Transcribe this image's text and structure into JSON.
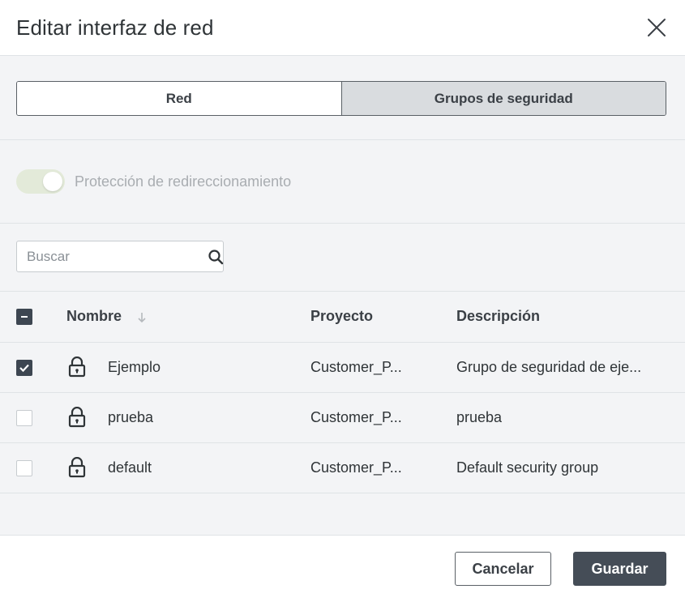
{
  "dialog": {
    "title": "Editar interfaz de red"
  },
  "tabs": [
    {
      "label": "Red",
      "active": true
    },
    {
      "label": "Grupos de seguridad",
      "active": false
    }
  ],
  "toggle": {
    "label": "Protección de redireccionamiento",
    "on": true,
    "disabled": true
  },
  "search": {
    "placeholder": "Buscar",
    "value": ""
  },
  "table": {
    "columns": [
      "Nombre",
      "Proyecto",
      "Descripción"
    ],
    "rows": [
      {
        "name": "Ejemplo",
        "project": "Customer_P...",
        "description": "Grupo de seguridad de eje...",
        "checked": true
      },
      {
        "name": "prueba",
        "project": "Customer_P...",
        "description": "prueba",
        "checked": false
      },
      {
        "name": "default",
        "project": "Customer_P...",
        "description": "Default security group",
        "checked": false
      }
    ]
  },
  "footer": {
    "cancel_label": "Cancelar",
    "save_label": "Guardar"
  },
  "colors": {
    "primary_button": "#454d57",
    "checkbox_checked": "#3d4651",
    "body_background": "#f3f4f6",
    "toggle_track": "#e3ead9"
  },
  "icons": {
    "close": "close-icon",
    "search": "search-icon",
    "lock": "lock-icon",
    "sort": "sort-down-arrow-icon",
    "check": "check-icon",
    "indeterminate": "minus-icon"
  }
}
